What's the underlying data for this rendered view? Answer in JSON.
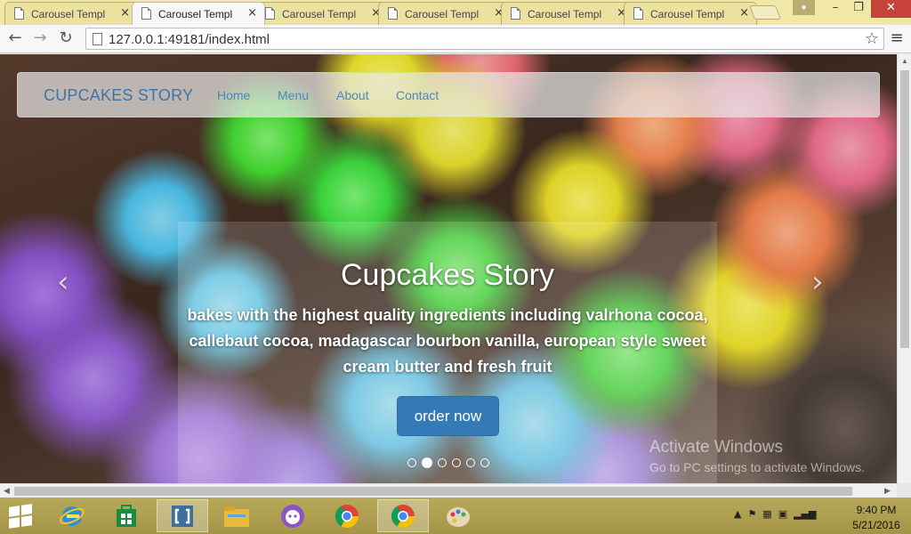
{
  "browser": {
    "tabs": [
      {
        "title": "Carousel Templ",
        "active": false
      },
      {
        "title": "Carousel Templ",
        "active": true
      },
      {
        "title": "Carousel Templ",
        "active": false
      },
      {
        "title": "Carousel Templ",
        "active": false
      },
      {
        "title": "Carousel Templ",
        "active": false
      },
      {
        "title": "Carousel Templ",
        "active": false
      }
    ],
    "tab_close_glyph": "×",
    "url": "127.0.0.1:49181/index.html",
    "icons": {
      "back": "←",
      "forward": "→",
      "reload": "↻",
      "bookmark": "☆",
      "menu": "≡",
      "minimize": "–",
      "maximize": "❐",
      "close": "✕"
    }
  },
  "page": {
    "navbar": {
      "brand": "CUPCAKES STORY",
      "links": [
        "Home",
        "Menu",
        "About",
        "Contact"
      ]
    },
    "carousel": {
      "title": "Cupcakes Story",
      "text": "bakes with the highest quality ingredients including valrhona cocoa, callebaut cocoa, madagascar bourbon vanilla, european style sweet cream butter and fresh fruit",
      "button_label": "order now",
      "prev_icon": "‹",
      "next_icon": "›",
      "indicator_count": 6,
      "active_indicator": 1
    },
    "watermark": {
      "title": "Activate Windows",
      "subtitle": "Go to PC settings to activate Windows."
    }
  },
  "taskbar": {
    "apps": [
      "start-icon",
      "internet-explorer-icon",
      "windows-store-icon",
      "brackets-icon",
      "file-explorer-icon",
      "github-icon",
      "chrome-icon",
      "chrome-active-icon",
      "paint-icon"
    ],
    "time": "9:40 PM",
    "date": "5/21/2016"
  },
  "colors": {
    "brand_blue": "#3f74a6",
    "link_blue": "#4d88bd",
    "button_blue": "#337ab7",
    "taskbar": "#a89a4d",
    "tabstrip": "#f1e7a6"
  }
}
